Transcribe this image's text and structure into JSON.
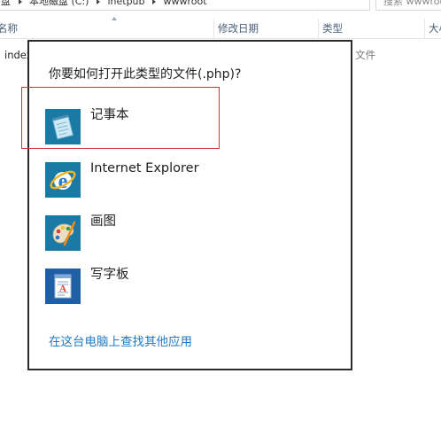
{
  "explorer": {
    "breadcrumb": [
      "本地磁盘 (C:)",
      "inetpub",
      "wwwroot"
    ],
    "breadcrumb_prefix": "盘",
    "search_placeholder": "搜索 wwwroot",
    "columns": {
      "name": "名称",
      "date_modified": "修改日期",
      "type": "类型",
      "size": "大小"
    },
    "file": {
      "name": "index.php",
      "type": "PHP 文件"
    }
  },
  "open_with": {
    "title": "你要如何打开此类型的文件(.php)?",
    "apps": [
      {
        "label": "记事本",
        "icon": "notepad-icon"
      },
      {
        "label": "Internet Explorer",
        "icon": "internet-explorer-icon"
      },
      {
        "label": "画图",
        "icon": "paint-icon"
      },
      {
        "label": "写字板",
        "icon": "wordpad-icon"
      }
    ],
    "more_apps_link": "在这台电脑上查找其他应用",
    "highlight_color": "#d0343a",
    "tile_color": "#1a7aa6",
    "link_color": "#1f7ac6"
  }
}
